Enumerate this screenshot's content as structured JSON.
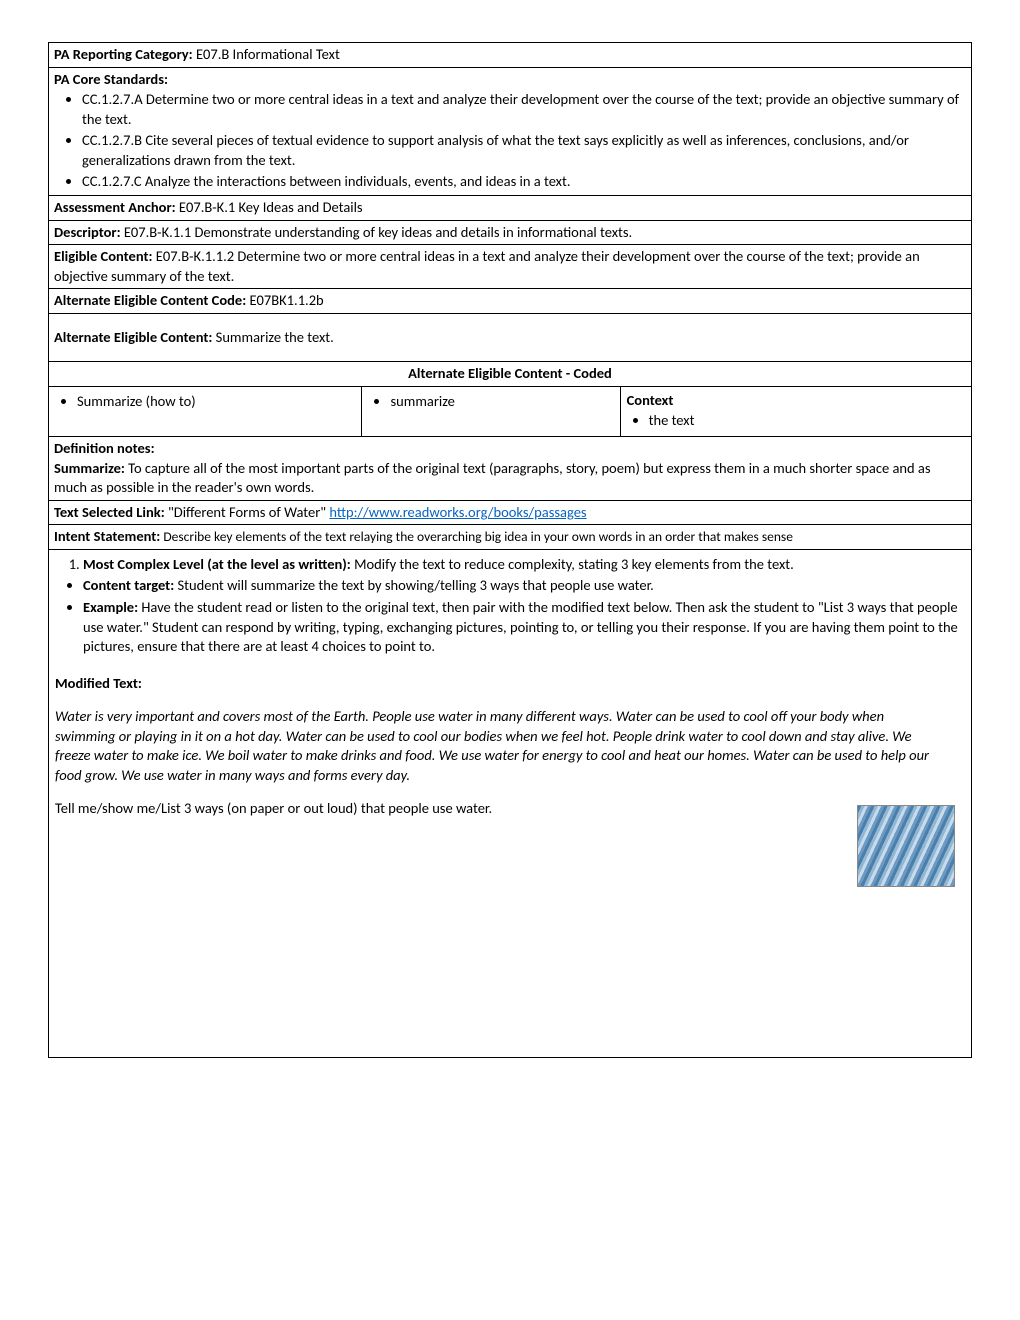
{
  "rows": {
    "reporting_label": "PA Reporting Category:",
    "reporting_value": "  E07.B Informational Text",
    "core_label": "PA Core Standards:",
    "core_items": [
      "CC.1.2.7.A Determine two or more central ideas in a text and analyze their development over the course of the text; provide an objective summary of the text.",
      "CC.1.2.7.B Cite several pieces of textual evidence to support analysis of what the text says explicitly as well as inferences, conclusions, and/or generalizations drawn from the text.",
      "CC.1.2.7.C Analyze the interactions between individuals, events, and ideas in a text."
    ],
    "anchor_label": "Assessment Anchor:",
    "anchor_value": "  E07.B-K.1 Key Ideas and Details",
    "descriptor_label": "Descriptor:",
    "descriptor_value": "  E07.B-K.1.1 Demonstrate understanding of key ideas and details in informational texts.",
    "eligible_label": "Eligible Content:",
    "eligible_value": "  E07.B-K.1.1.2 Determine two or more central ideas in a text and analyze their development over the course of the text; provide an objective summary of the text.",
    "altcode_label": "Alternate Eligible Content Code:",
    "altcode_value": " E07BK1.1.2b",
    "altcontent_label": "Alternate Eligible Content:",
    "altcontent_value": "  Summarize the text."
  },
  "coded": {
    "header": "Alternate Eligible Content - Coded",
    "col1_item": "Summarize (how to)",
    "col2_item": "summarize",
    "col3_label": "Context",
    "col3_item": "the text"
  },
  "definition": {
    "label": "Definition notes:",
    "term": "Summarize:",
    "text": " To capture all of the most important parts of the original text (paragraphs, story, poem) but express them in a much shorter space and as much as possible in the reader's own words."
  },
  "link_row": {
    "label": "Text Selected Link:",
    "title": " \"Different Forms of Water\" ",
    "url_text": "http://www.readworks.org/books/passages",
    "url_href": "http://www.readworks.org/books/passages"
  },
  "intent": {
    "label": "Intent Statement:",
    "text": " Describe key elements of the text relaying the overarching big idea in your own words in an order that makes sense"
  },
  "body": {
    "item1_label": "Most Complex Level (at the level as written):",
    "item1_text": " Modify the text to reduce complexity, stating 3 key elements from the text.",
    "target_label": "Content target:",
    "target_text": " Student will summarize the text by showing/telling 3 ways that people use water.",
    "example_label": "Example:",
    "example_text": " Have the student read or listen to the original text, then pair with the modified text below. Then ask the student to \"List 3 ways that people use water.\" Student can respond by writing, typing, exchanging pictures, pointing to, or telling you their response. If you are having them point to the pictures, ensure that there are at least 4 choices to point to.",
    "mod_label": "Modified Text:",
    "mod_para": "Water is very important and covers most of the Earth. People use water in many different ways. Water can be used to cool off your body when swimming or playing in it on a hot day. Water can be used to cool our bodies when we feel hot. People drink water to cool down and stay alive. We freeze water to make ice. We boil water to make drinks and food. We use water for energy to cool and heat our homes. Water can be used to help our food grow. We use water in many ways and forms every day.",
    "prompt": "Tell me/show me/List 3 ways (on paper or out loud) that people use water."
  }
}
